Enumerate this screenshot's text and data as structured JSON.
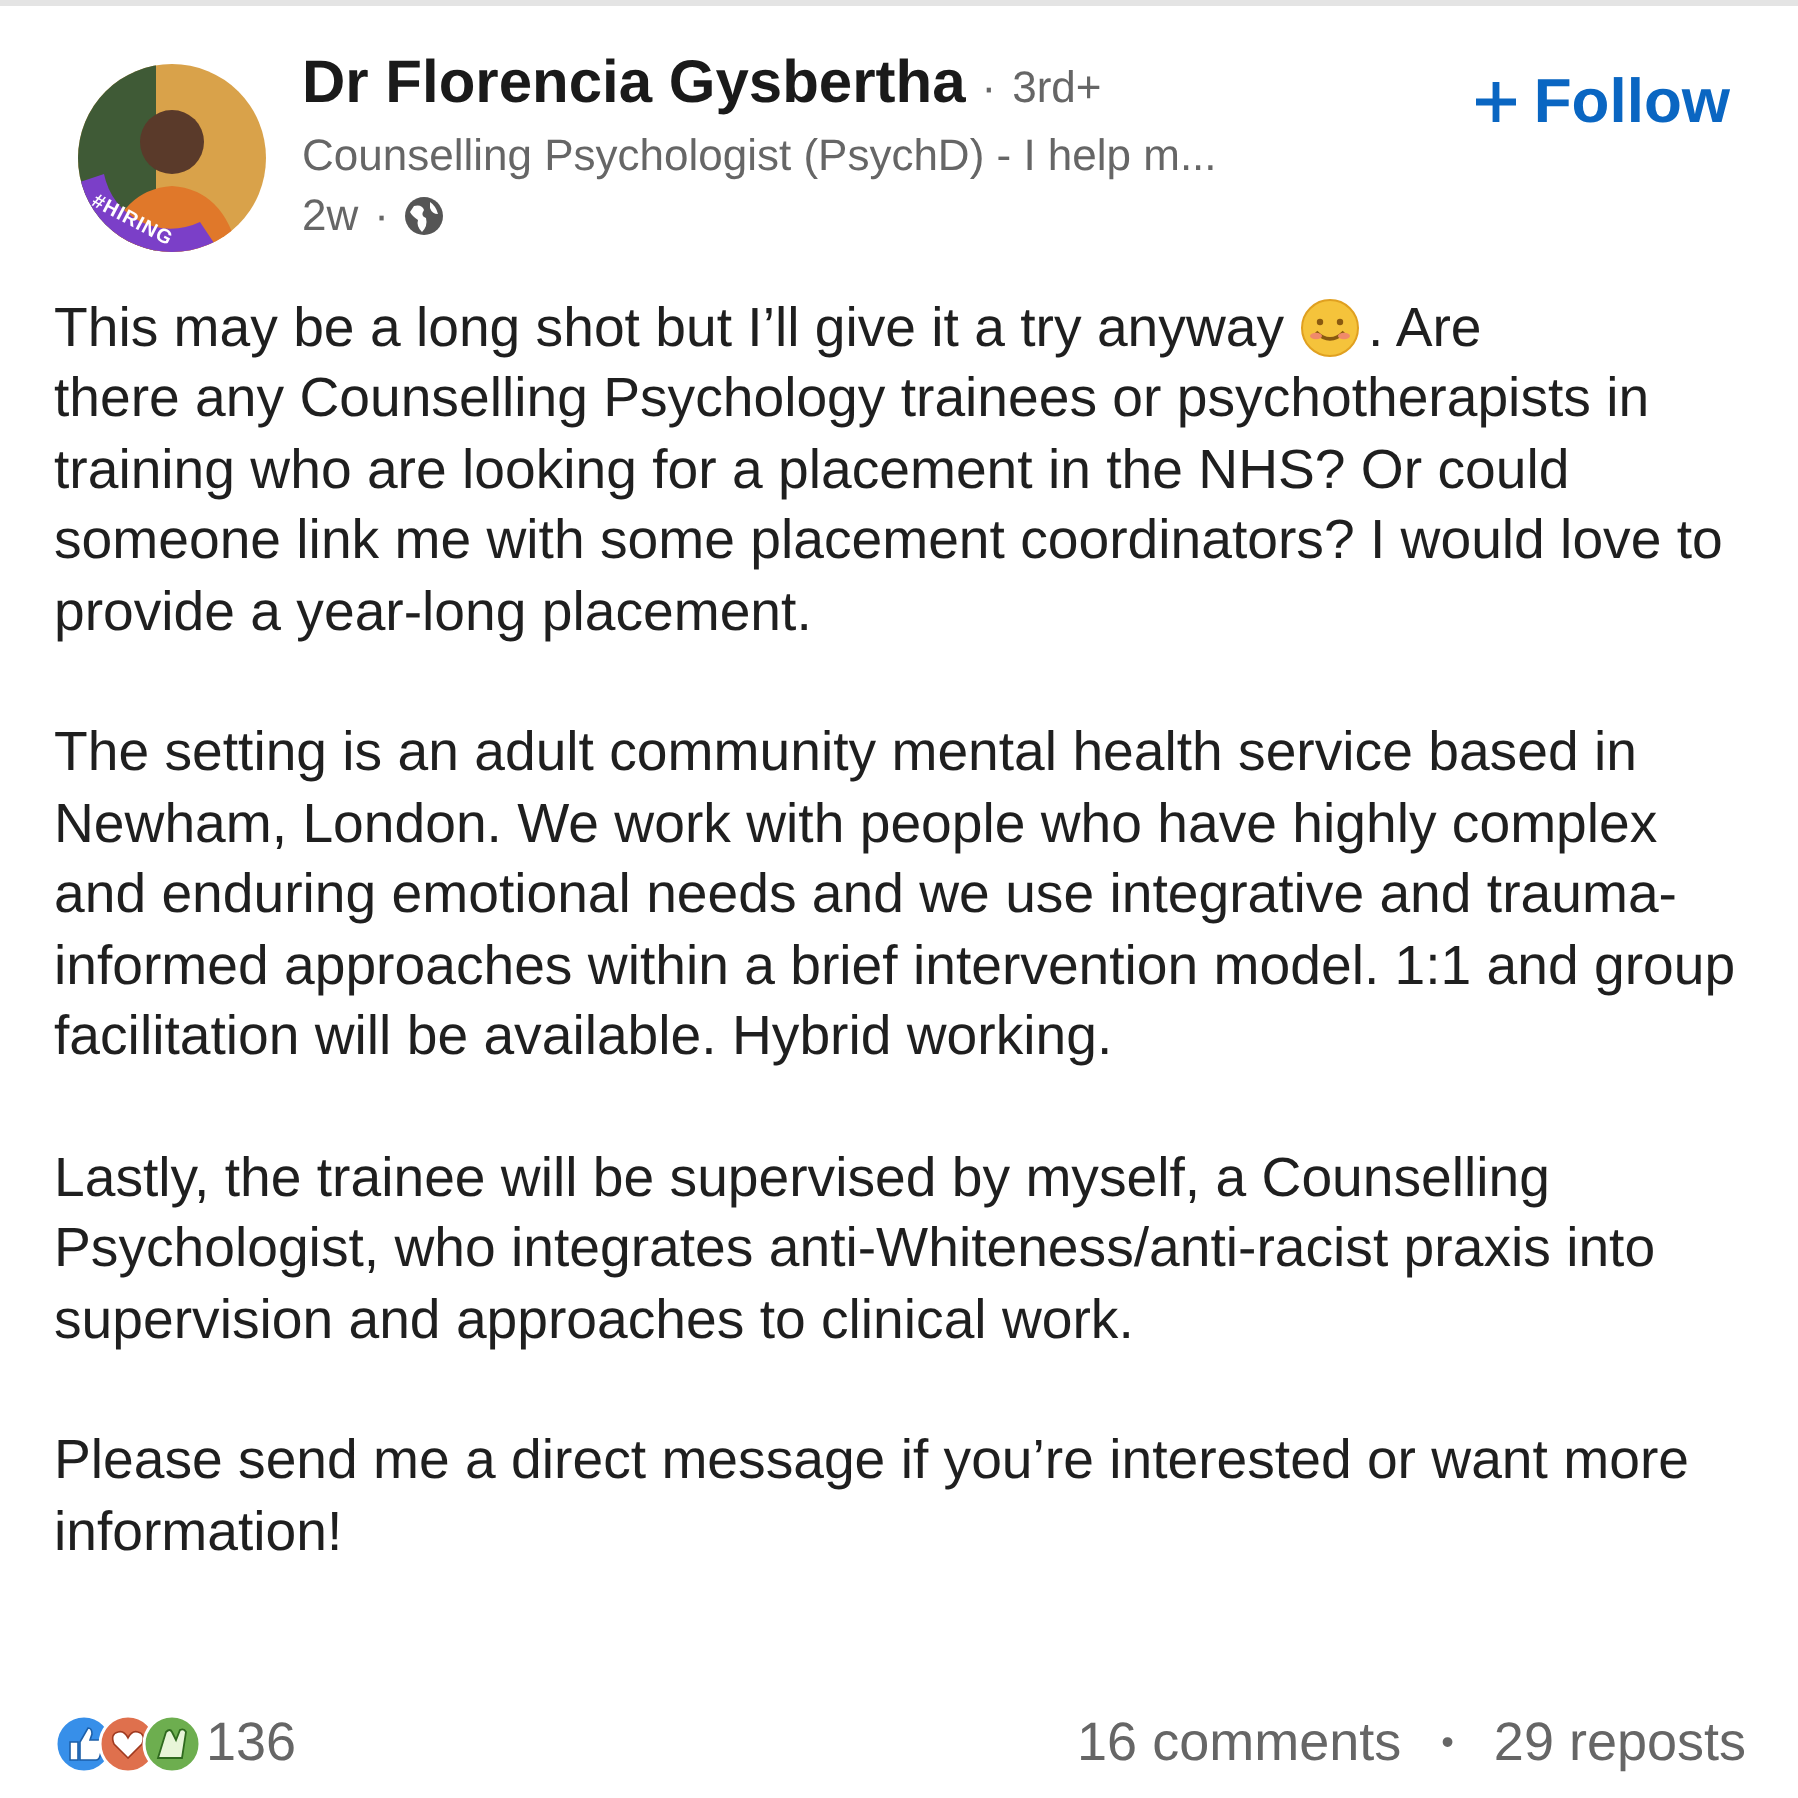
{
  "post": {
    "author": {
      "name": "Dr Florencia Gysbertha",
      "separator": "·",
      "degree": "3rd+",
      "headline": "Counselling Psychologist (PsychD) - I help m...",
      "time": "2w",
      "time_separator": "·",
      "badge": "#HIRING"
    },
    "follow_button": {
      "label": "Follow"
    },
    "body": [
      {
        "segments": [
          {
            "kind": "inline",
            "text": "This may be a long shot but I’ll give it a try anyway"
          },
          {
            "kind": "emoji"
          },
          {
            "kind": "inline",
            "text": ". Are"
          },
          {
            "kind": "text",
            "text": "there any Counselling Psychology trainees or psychotherapists in training who are looking for a placement in the NHS? Or could someone link me with some placement coordinators? I would love to provide a year-long placement."
          }
        ]
      },
      {
        "segments": [
          {
            "kind": "text",
            "text": "The setting is an adult community mental health service based in Newham, London. We work with people who have highly complex and enduring emotional needs and we use integrative and trauma-informed approaches within a brief intervention model. 1:1 and group facilitation will be available. Hybrid working."
          }
        ]
      },
      {
        "segments": [
          {
            "kind": "text",
            "text": "Lastly, the trainee will be supervised by myself, a Counselling Psychologist, who integrates anti-Whiteness/anti-racist praxis into supervision and approaches to clinical work."
          }
        ]
      },
      {
        "segments": [
          {
            "kind": "text",
            "text": "Please send me a direct message if you’re interested or want more information!"
          }
        ]
      }
    ],
    "social": {
      "reactions": [
        {
          "kind": "like"
        },
        {
          "kind": "love"
        },
        {
          "kind": "celebrate"
        }
      ],
      "reaction_count": "136",
      "comments": "16 comments",
      "separator": "•",
      "reposts": "29 reposts"
    }
  }
}
